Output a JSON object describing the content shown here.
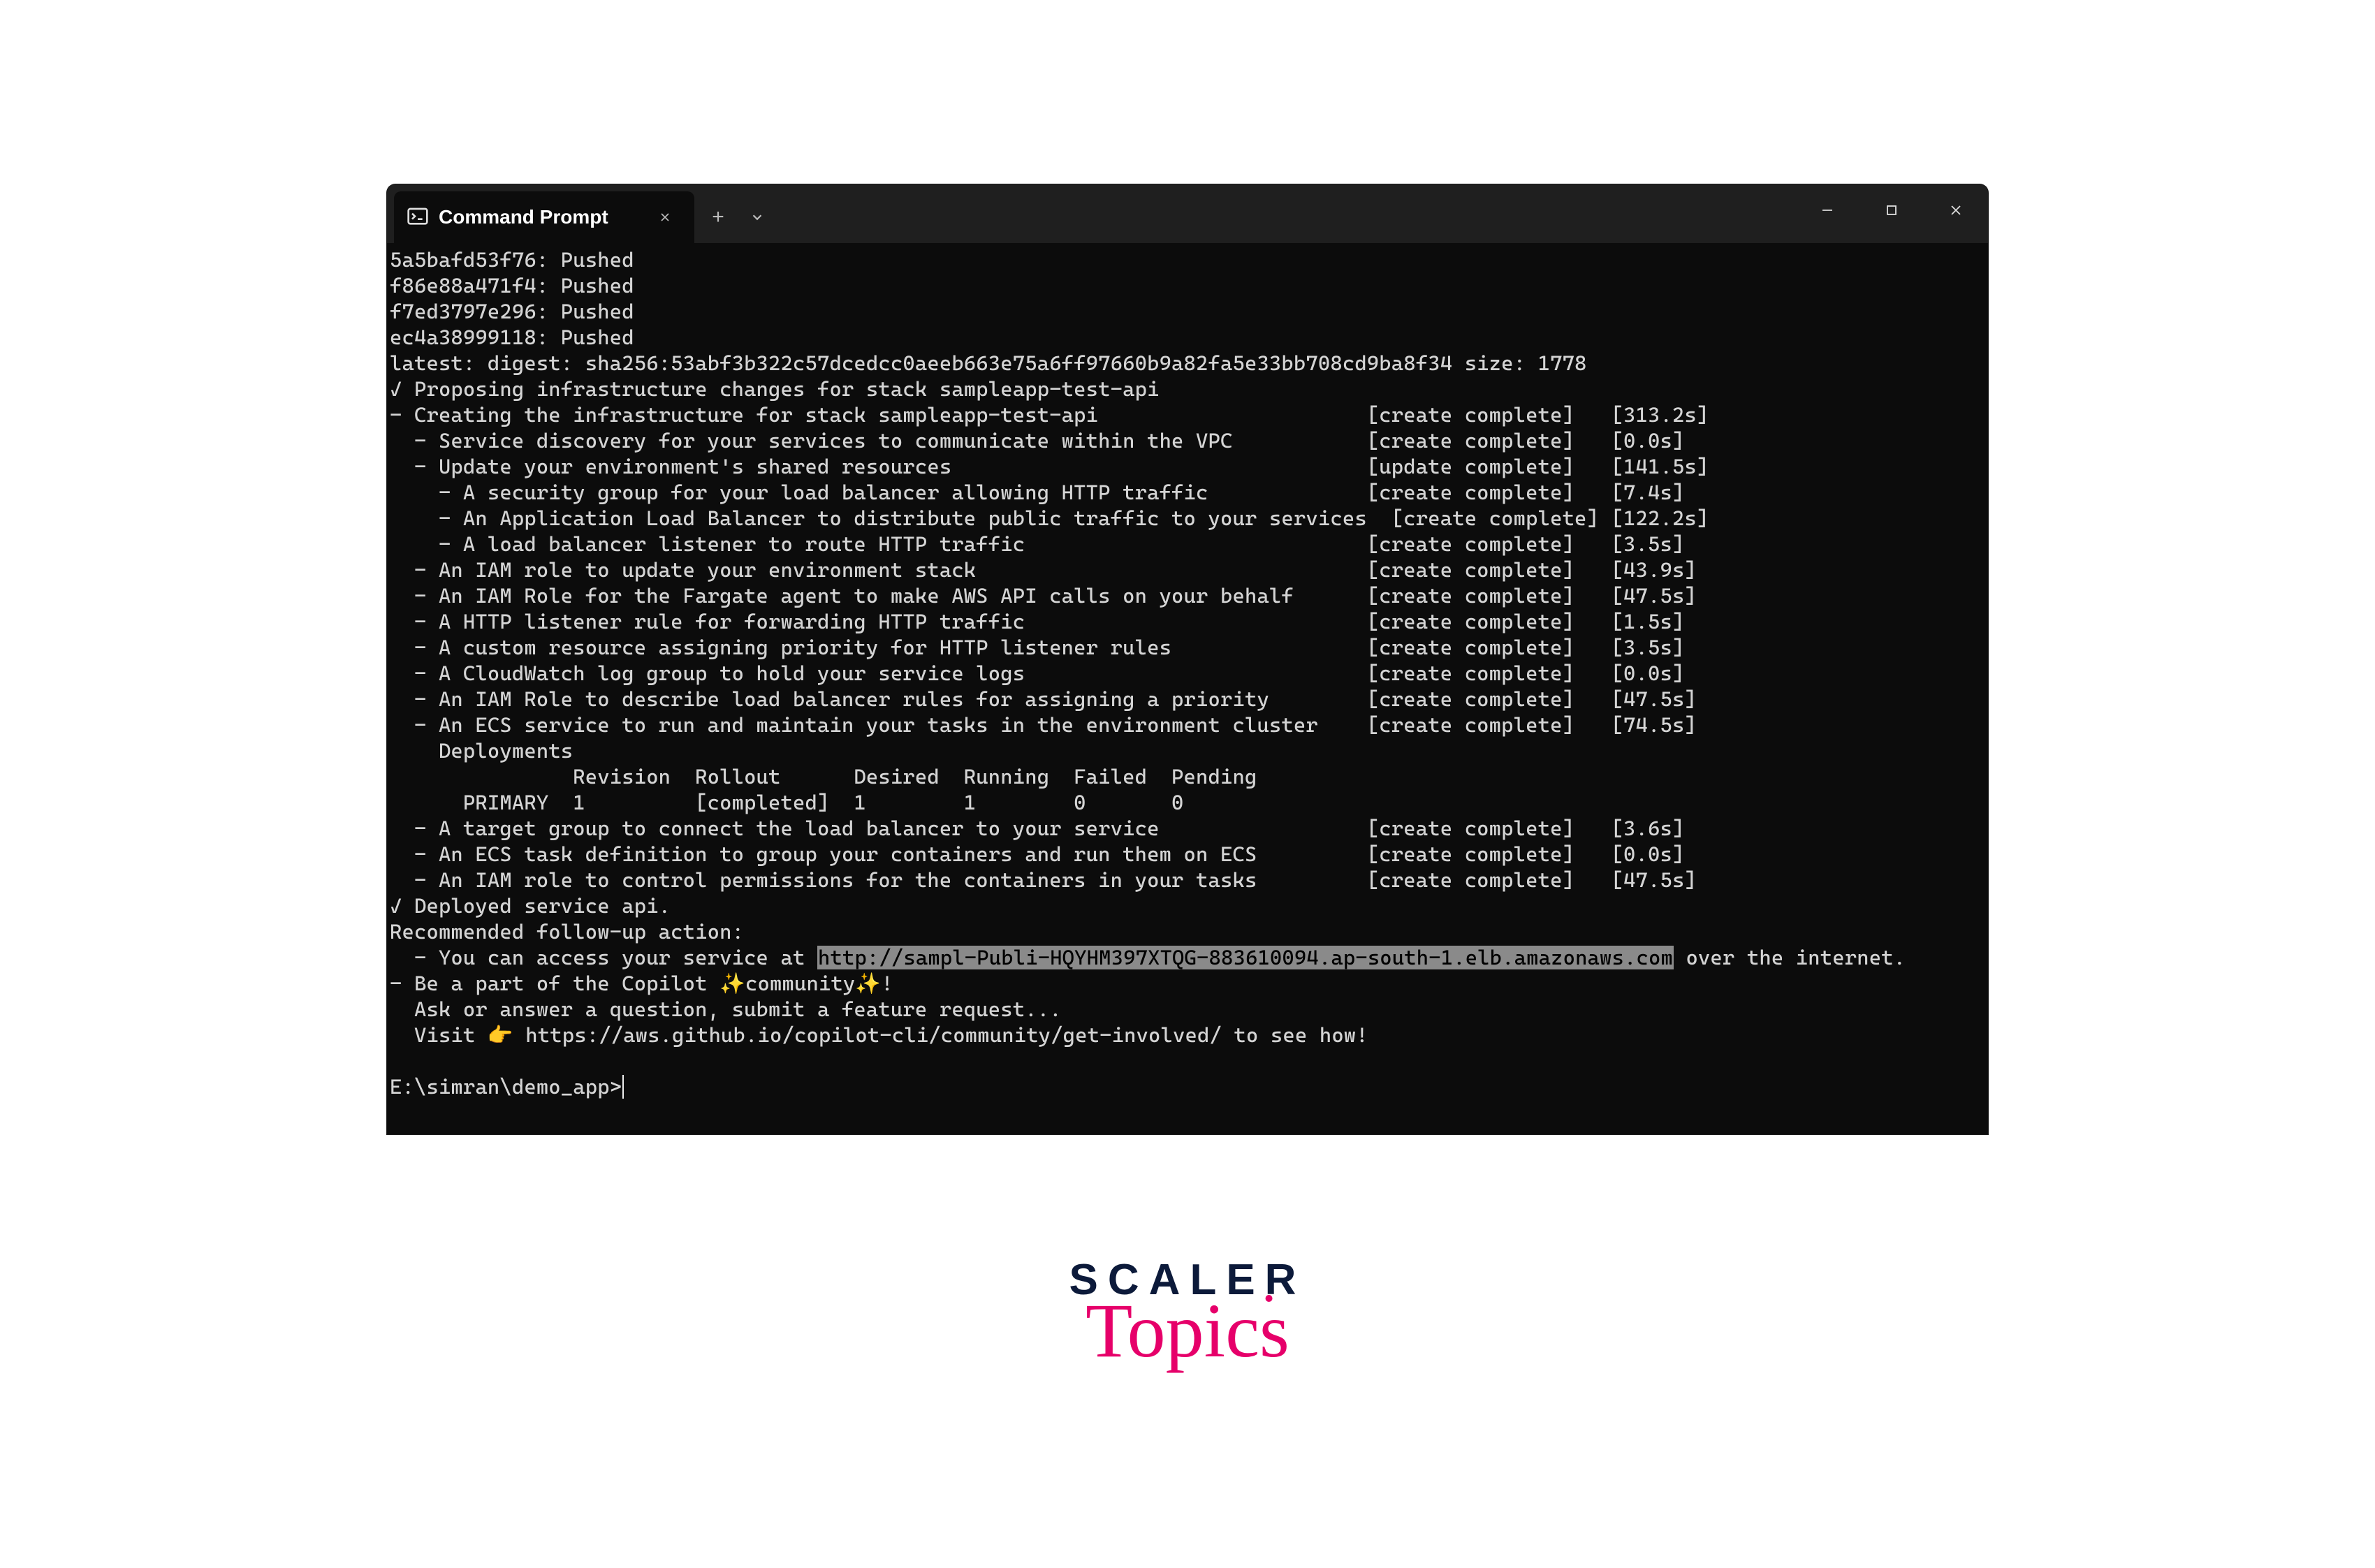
{
  "window": {
    "tab_title": "Command Prompt",
    "tab_close_label": "✕",
    "add_tab_label": "+",
    "minimize_label": "Minimize",
    "maximize_label": "Maximize",
    "close_label": "Close"
  },
  "terminal": {
    "pushed": [
      {
        "hash": "5a5bafd53f76",
        "status": "Pushed"
      },
      {
        "hash": "f86e88a471f4",
        "status": "Pushed"
      },
      {
        "hash": "f7ed3797e296",
        "status": "Pushed"
      },
      {
        "hash": "ec4a38999118",
        "status": "Pushed"
      }
    ],
    "digest_line": "latest: digest: sha256:53abf3b322c57dcedcc0aeeb663e75a6ff97660b9a82fa5e33bb708cd9ba8f34 size: 1778",
    "proposing_line": "✓ Proposing infrastructure changes for stack sampleapp-test-api",
    "stack_header": {
      "text": "- Creating the infrastructure for stack sampleapp-test-api",
      "status": "[create complete]",
      "time": "[313.2s]"
    },
    "entries": [
      {
        "indent": 1,
        "text": "- Service discovery for your services to communicate within the VPC",
        "status": "[create complete]",
        "time": "[0.0s]"
      },
      {
        "indent": 1,
        "text": "- Update your environment's shared resources",
        "status": "[update complete]",
        "time": "[141.5s]"
      },
      {
        "indent": 2,
        "text": "- A security group for your load balancer allowing HTTP traffic",
        "status": "[create complete]",
        "time": "[7.4s]"
      },
      {
        "indent": 2,
        "text": "- An Application Load Balancer to distribute public traffic to your services",
        "status": "[create complete]",
        "time": "[122.2s]"
      },
      {
        "indent": 2,
        "text": "- A load balancer listener to route HTTP traffic",
        "status": "[create complete]",
        "time": "[3.5s]"
      },
      {
        "indent": 1,
        "text": "- An IAM role to update your environment stack",
        "status": "[create complete]",
        "time": "[43.9s]"
      },
      {
        "indent": 1,
        "text": "- An IAM Role for the Fargate agent to make AWS API calls on your behalf",
        "status": "[create complete]",
        "time": "[47.5s]"
      },
      {
        "indent": 1,
        "text": "- A HTTP listener rule for forwarding HTTP traffic",
        "status": "[create complete]",
        "time": "[1.5s]"
      },
      {
        "indent": 1,
        "text": "- A custom resource assigning priority for HTTP listener rules",
        "status": "[create complete]",
        "time": "[3.5s]"
      },
      {
        "indent": 1,
        "text": "- A CloudWatch log group to hold your service logs",
        "status": "[create complete]",
        "time": "[0.0s]"
      },
      {
        "indent": 1,
        "text": "- An IAM Role to describe load balancer rules for assigning a priority",
        "status": "[create complete]",
        "time": "[47.5s]"
      },
      {
        "indent": 1,
        "text": "- An ECS service to run and maintain your tasks in the environment cluster",
        "status": "[create complete]",
        "time": "[74.5s]"
      }
    ],
    "deployments_label": "    Deployments",
    "deployments_header": "               Revision  Rollout      Desired  Running  Failed  Pending",
    "deployments_row": "      PRIMARY  1         [completed]  1        1        0       0",
    "post_entries": [
      {
        "indent": 1,
        "text": "- A target group to connect the load balancer to your service",
        "status": "[create complete]",
        "time": "[3.6s]"
      },
      {
        "indent": 1,
        "text": "- An ECS task definition to group your containers and run them on ECS",
        "status": "[create complete]",
        "time": "[0.0s]"
      },
      {
        "indent": 1,
        "text": "- An IAM role to control permissions for the containers in your tasks",
        "status": "[create complete]",
        "time": "[47.5s]"
      }
    ],
    "deployed_line": "✓ Deployed service api.",
    "followup_header": "Recommended follow-up action:",
    "access_prefix": "  - You can access your service at ",
    "access_url": "http://sampl-Publi-HQYHM397XTQG-883610094.ap-south-1.elb.amazonaws.com",
    "access_suffix": " over the internet.",
    "community_line": "- Be a part of the Copilot ✨community✨!",
    "ask_line": "  Ask or answer a question, submit a feature request...",
    "visit_line": "  Visit 👉 https://aws.github.io/copilot-cli/community/get-involved/ to see how!",
    "prompt": "E:\\simran\\demo_app>"
  },
  "logo": {
    "top": "SCALER",
    "script": "Topics"
  }
}
